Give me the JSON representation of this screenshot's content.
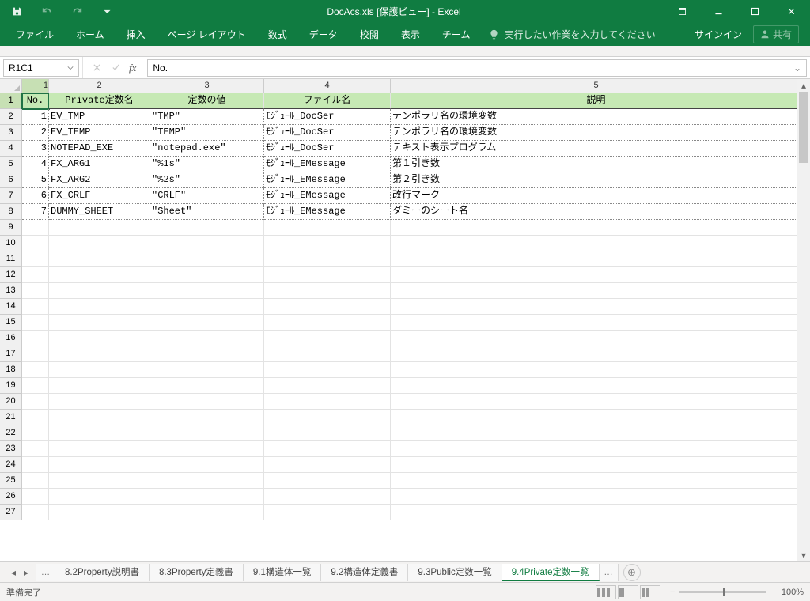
{
  "app": {
    "title": "DocAcs.xls  [保護ビュー] - Excel"
  },
  "ribbon": {
    "tabs": [
      "ファイル",
      "ホーム",
      "挿入",
      "ページ レイアウト",
      "数式",
      "データ",
      "校閲",
      "表示",
      "チーム"
    ],
    "tell_me": "実行したい作業を入力してください",
    "signin": "サインイン",
    "share": "共有"
  },
  "fx": {
    "name_box": "R1C1",
    "formula": "No."
  },
  "columns": [
    "1",
    "2",
    "3",
    "4",
    "5"
  ],
  "headers": [
    "No.",
    "Private定数名",
    "定数の値",
    "ファイル名",
    "説明"
  ],
  "rows": [
    {
      "no": "1",
      "name": "EV_TMP",
      "val": "\"TMP\"",
      "file": "ﾓｼﾞｭｰﾙ_DocSer",
      "desc": "テンポラリ名の環境変数"
    },
    {
      "no": "2",
      "name": "EV_TEMP",
      "val": "\"TEMP\"",
      "file": "ﾓｼﾞｭｰﾙ_DocSer",
      "desc": "テンポラリ名の環境変数"
    },
    {
      "no": "3",
      "name": "NOTEPAD_EXE",
      "val": "\"notepad.exe\"",
      "file": "ﾓｼﾞｭｰﾙ_DocSer",
      "desc": "テキスト表示プログラム"
    },
    {
      "no": "4",
      "name": "FX_ARG1",
      "val": "\"%1s\"",
      "file": "ﾓｼﾞｭｰﾙ_EMessage",
      "desc": "第１引き数"
    },
    {
      "no": "5",
      "name": "FX_ARG2",
      "val": "\"%2s\"",
      "file": "ﾓｼﾞｭｰﾙ_EMessage",
      "desc": "第２引き数"
    },
    {
      "no": "6",
      "name": "FX_CRLF",
      "val": "\"CRLF\"",
      "file": "ﾓｼﾞｭｰﾙ_EMessage",
      "desc": "改行マーク"
    },
    {
      "no": "7",
      "name": "DUMMY_SHEET",
      "val": "\"Sheet\"",
      "file": "ﾓｼﾞｭｰﾙ_EMessage",
      "desc": "ダミーのシート名"
    }
  ],
  "empty_row_count": 19,
  "sheet_tabs": {
    "list": [
      "8.2Property説明書",
      "8.3Property定義書",
      "9.1構造体一覧",
      "9.2構造体定義書",
      "9.3Public定数一覧",
      "9.4Private定数一覧"
    ],
    "active_index": 5
  },
  "status": {
    "ready": "準備完了",
    "zoom": "100%"
  }
}
